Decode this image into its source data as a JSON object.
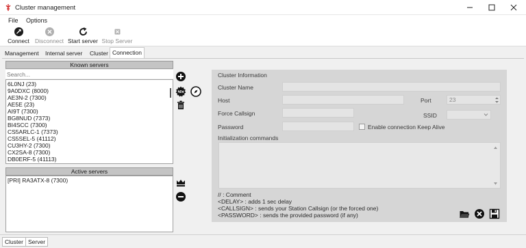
{
  "window": {
    "title": "Cluster management",
    "accent_color": "#d22a2a"
  },
  "menu": {
    "items": [
      {
        "label": "File"
      },
      {
        "label": "Options"
      }
    ]
  },
  "toolbar": {
    "buttons": [
      {
        "label": "Connect",
        "icon": "connect-icon",
        "enabled": true
      },
      {
        "label": "Disconnect",
        "icon": "disconnect-icon",
        "enabled": false
      },
      {
        "label": "Start server",
        "icon": "refresh-icon",
        "enabled": true
      },
      {
        "label": "Stop Server",
        "icon": "stop-icon",
        "enabled": false
      }
    ]
  },
  "tabs": [
    {
      "label": "Management",
      "active": false
    },
    {
      "label": "Internal server",
      "active": false
    },
    {
      "label": "Cluster",
      "active": false
    },
    {
      "label": "Connection",
      "active": true
    }
  ],
  "known_servers": {
    "header": "Known servers",
    "search_placeholder": "Search...",
    "items": [
      "6L0NJ (23)",
      "9A0DXC (8000)",
      "AE3N-2 (7300)",
      "AE5E (23)",
      "AI9T (7300)",
      "BG8NUD (7373)",
      "BI4SCC (7300)",
      "CS5ARLC-1 (7373)",
      "CS5SEL-5 (41112)",
      "CU3HY-2 (7300)",
      "CX2SA-8 (7300)",
      "DB0ERF-5 (41113)"
    ]
  },
  "active_servers": {
    "header": "Active servers",
    "items": [
      "[PRI] RA3ATX-8 (7300)"
    ]
  },
  "cluster_info": {
    "section_title": "Cluster Information",
    "name_label": "Cluster Name",
    "host_label": "Host",
    "port_label": "Port",
    "port_value": "23",
    "force_callsign_label": "Force Callsign",
    "ssid_label": "SSID",
    "password_label": "Password",
    "keepalive_label": "Enable connection Keep Alive",
    "init_label": "Initialization commands",
    "help": [
      "// : Comment",
      "<DELAY> : adds 1 sec delay",
      "<CALLSIGN> : sends your Station Callsign (or the forced one)",
      "<PASSWORD> : sends the provided password (if any)"
    ]
  },
  "status_tabs": [
    {
      "label": "Cluster"
    },
    {
      "label": "Server"
    }
  ]
}
